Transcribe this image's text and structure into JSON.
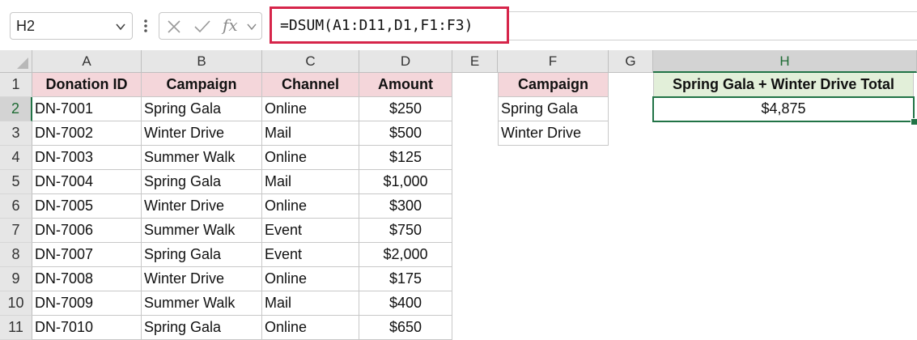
{
  "name_box": {
    "value": "H2"
  },
  "formula_bar": {
    "fx_label": "fx",
    "formula": "=DSUM(A1:D11,D1,F1:F3)"
  },
  "icons": {
    "name_box_dropdown": "chevron-down-icon",
    "more": "vertical-dots-icon",
    "cancel": "x-icon",
    "enter": "checkmark-icon",
    "insert_function": "fx-icon",
    "formula_dropdown": "chevron-down-icon",
    "select_all": "select-all-triangle-icon"
  },
  "colors": {
    "header_pink": "#f4d6da",
    "header_green": "#e2efd9",
    "selection_green": "#217346",
    "formula_highlight": "#d6254a"
  },
  "columns": [
    "A",
    "B",
    "C",
    "D",
    "E",
    "F",
    "G",
    "H"
  ],
  "rows": [
    "1",
    "2",
    "3",
    "4",
    "5",
    "6",
    "7",
    "8",
    "9",
    "10",
    "11"
  ],
  "main_table": {
    "headers": [
      "Donation ID",
      "Campaign",
      "Channel",
      "Amount"
    ],
    "rows": [
      [
        "DN-7001",
        "Spring Gala",
        "Online",
        "$250"
      ],
      [
        "DN-7002",
        "Winter Drive",
        "Mail",
        "$500"
      ],
      [
        "DN-7003",
        "Summer Walk",
        "Online",
        "$125"
      ],
      [
        "DN-7004",
        "Spring Gala",
        "Mail",
        "$1,000"
      ],
      [
        "DN-7005",
        "Winter Drive",
        "Online",
        "$300"
      ],
      [
        "DN-7006",
        "Summer Walk",
        "Event",
        "$750"
      ],
      [
        "DN-7007",
        "Spring Gala",
        "Event",
        "$2,000"
      ],
      [
        "DN-7008",
        "Winter Drive",
        "Online",
        "$175"
      ],
      [
        "DN-7009",
        "Summer Walk",
        "Mail",
        "$400"
      ],
      [
        "DN-7010",
        "Spring Gala",
        "Online",
        "$650"
      ]
    ]
  },
  "criteria_table": {
    "header": "Campaign",
    "rows": [
      "Spring Gala",
      "Winter Drive"
    ]
  },
  "result": {
    "header": "Spring Gala + Winter Drive Total",
    "value": "$4,875"
  },
  "selection": {
    "cell": "H2"
  }
}
